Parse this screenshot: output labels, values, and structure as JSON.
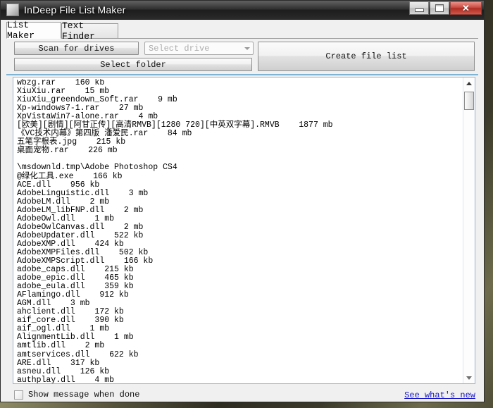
{
  "window": {
    "title": "InDeep File List Maker",
    "icon": "app-icon",
    "controls": {
      "minimize": "minimize-icon",
      "maximize": "maximize-icon",
      "close": "close-icon",
      "close_glyph": "✕"
    }
  },
  "tabs": [
    {
      "label": "List Maker",
      "active": true
    },
    {
      "label": "Text Finder",
      "active": false
    }
  ],
  "toolbar": {
    "scan_label": "Scan for drives",
    "folder_label": "Select folder",
    "create_label": "Create file list",
    "drive_placeholder": "Select drive",
    "drive_arrow_icon": "chevron-down-icon"
  },
  "file_list": {
    "text": "wbzg.rar    160 kb\nXiuXiu.rar    15 mb\nXiuXiu_greendown_Soft.rar    9 mb\nXp-windows7-1.rar    27 mb\nXpVistaWin7-alone.rar    4 mb\n[欧美][剧情][阿甘正传][高清RMVB][1280 720][中英双字幕].RMVB    1877 mb\n《VC技术内幕》第四版 潘爱民.rar    84 mb\n五笔字根表.jpg    215 kb\n桌面宠物.rar    226 mb\n\n\\msdownld.tmp\\Adobe Photoshop CS4\n@绿化工具.exe    166 kb\nACE.dll    956 kb\nAdobeLinguistic.dll    3 mb\nAdobeLM.dll    2 mb\nAdobeLM_libFNP.dll    2 mb\nAdobeOwl.dll    1 mb\nAdobeOwlCanvas.dll    2 mb\nAdobeUpdater.dll    522 kb\nAdobeXMP.dll    424 kb\nAdobeXMPFiles.dll    502 kb\nAdobeXMPScript.dll    166 kb\nadobe_caps.dll    215 kb\nadobe_epic.dll    465 kb\nadobe_eula.dll    359 kb\nAFlamingo.dll    912 kb\nAGM.dll    3 mb\nahclient.dll    172 kb\naif_core.dll    390 kb\naif_ogl.dll    1 mb\nAlignmentLib.dll    1 mb\namtlib.dll    2 mb\namtservices.dll    622 kb\nARE.dll    317 kb\nasneu.dll    126 kb\nauthplay.dll    4 mb"
  },
  "scrollbar": {
    "up_icon": "scroll-up-arrow-icon",
    "down_icon": "scroll-down-arrow-icon"
  },
  "status": {
    "checkbox_label": "Show message when done",
    "checkbox_checked": false,
    "link_label": "See what's new"
  }
}
